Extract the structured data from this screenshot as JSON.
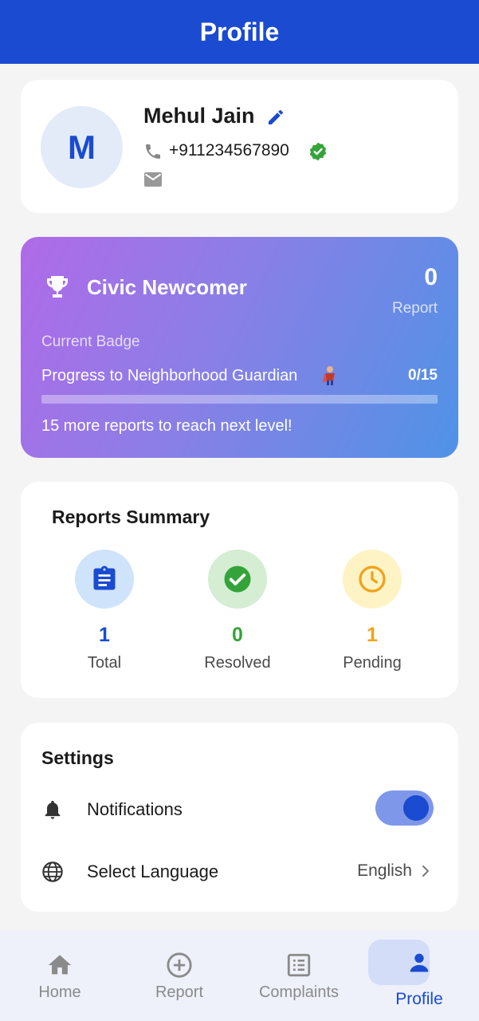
{
  "header": {
    "title": "Profile"
  },
  "profile": {
    "avatar_initial": "M",
    "name": "Mehul Jain",
    "phone": "+911234567890"
  },
  "badge": {
    "title": "Civic Newcomer",
    "report_count": "0",
    "report_label": "Report",
    "current_badge_label": "Current Badge",
    "progress_label": "Progress to Neighborhood Guardian",
    "progress_count": "0/15",
    "progress_fraction": 0,
    "next_level_text": "15 more reports to reach next level!"
  },
  "summary": {
    "title": "Reports Summary",
    "stats": [
      {
        "value": "1",
        "label": "Total",
        "icon": "clipboard-icon",
        "color": "#1a4bd1",
        "bg": "#cfe3fb"
      },
      {
        "value": "0",
        "label": "Resolved",
        "icon": "check-circle-icon",
        "color": "#34a43a",
        "bg": "#d4edd3"
      },
      {
        "value": "1",
        "label": "Pending",
        "icon": "clock-icon",
        "color": "#f0a21c",
        "bg": "#fdf3c4"
      }
    ]
  },
  "settings": {
    "title": "Settings",
    "notifications_label": "Notifications",
    "notifications_enabled": true,
    "language_label": "Select Language",
    "language_value": "English"
  },
  "nav": {
    "items": [
      {
        "label": "Home",
        "icon": "home-icon"
      },
      {
        "label": "Report",
        "icon": "add-circle-icon"
      },
      {
        "label": "Complaints",
        "icon": "list-icon"
      },
      {
        "label": "Profile",
        "icon": "person-icon"
      }
    ],
    "active": "Profile"
  },
  "colors": {
    "primary": "#1a4bd1",
    "background": "#f4f4f4",
    "verified": "#34a43a"
  }
}
